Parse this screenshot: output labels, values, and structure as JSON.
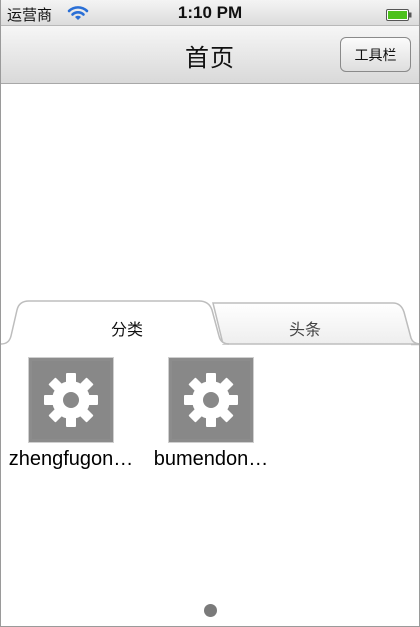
{
  "status_bar": {
    "carrier": "运营商",
    "time": "1:10 PM",
    "wifi_icon": "wifi-icon",
    "battery_icon": "battery-icon",
    "battery_color": "#4cc11c"
  },
  "nav_bar": {
    "title": "首页",
    "toolbar_button_label": "工具栏"
  },
  "tabs": [
    {
      "label": "分类",
      "selected": true
    },
    {
      "label": "头条",
      "selected": false
    }
  ],
  "grid": {
    "icon": "gear-icon",
    "items": [
      {
        "label": "zhengfugon…"
      },
      {
        "label": "bumendon…"
      }
    ]
  },
  "page_indicator": {
    "pages": 1,
    "current": 1
  },
  "colors": {
    "icon_background": "#888888",
    "page_dot": "#7a7a7a"
  }
}
